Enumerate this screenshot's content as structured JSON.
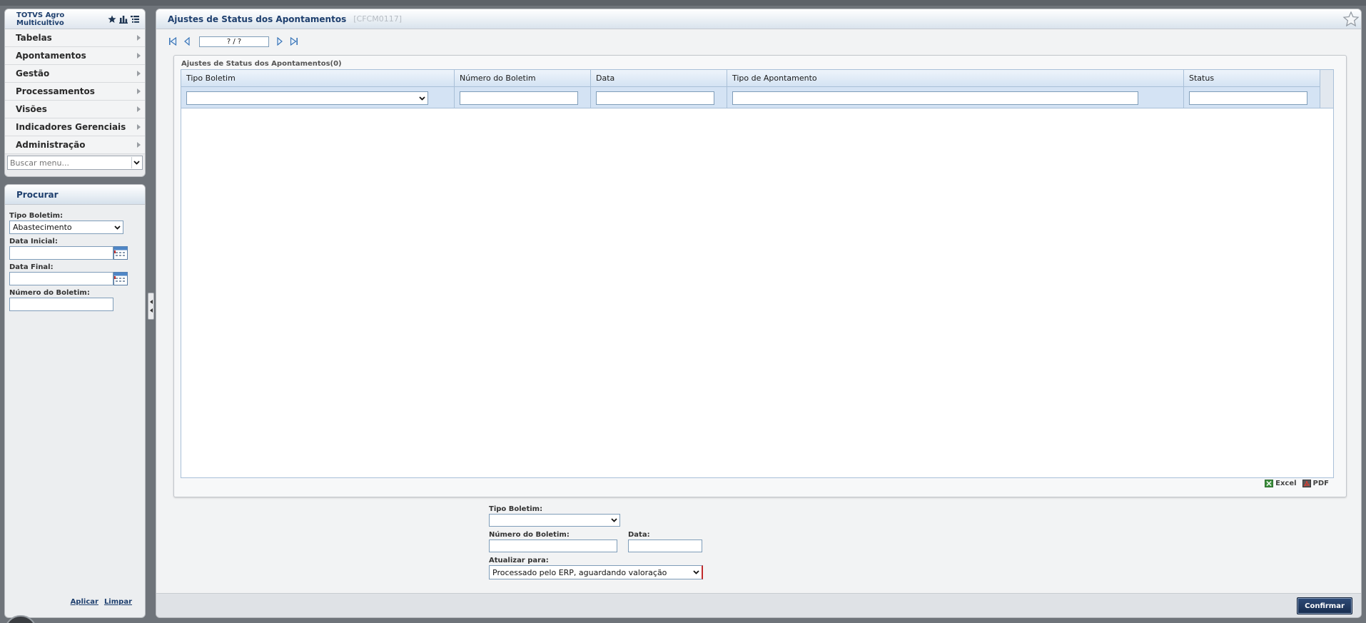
{
  "menu": {
    "title": "TOTVS Agro Multicultivo",
    "items": [
      {
        "label": "Tabelas"
      },
      {
        "label": "Apontamentos"
      },
      {
        "label": "Gestão"
      },
      {
        "label": "Processamentos"
      },
      {
        "label": "Visões"
      },
      {
        "label": "Indicadores Gerenciais"
      },
      {
        "label": "Administração"
      }
    ],
    "search_placeholder": "Buscar menu..."
  },
  "procurar": {
    "title": "Procurar",
    "tipo_boletim_label": "Tipo Boletim:",
    "tipo_boletim_value": "Abastecimento",
    "data_inicial_label": "Data Inicial:",
    "data_final_label": "Data Final:",
    "numero_boletim_label": "Número do Boletim:",
    "apply_label": "Aplicar",
    "clear_label": "Limpar"
  },
  "main": {
    "title": "Ajustes de Status dos Apontamentos",
    "code": "[CFCM0117]",
    "pager_text": "? / ?",
    "grid_caption": "Ajustes de Status dos Apontamentos(0)",
    "columns": [
      {
        "label": "Tipo Boletim"
      },
      {
        "label": "Número do Boletim"
      },
      {
        "label": "Data"
      },
      {
        "label": "Tipo de Apontamento"
      },
      {
        "label": "Status"
      }
    ],
    "export_excel": "Excel",
    "export_pdf": "PDF"
  },
  "form": {
    "tipo_boletim_label": "Tipo Boletim:",
    "numero_boletim_label": "Número do Boletim:",
    "data_label": "Data:",
    "atualizar_label": "Atualizar para:",
    "atualizar_value": "Processado pelo ERP, aguardando valoração",
    "confirm_label": "Confirmar"
  },
  "colors": {
    "title_blue": "#1e3f6e",
    "confirm_bg": "#1f3861",
    "field_border": "#7f9db9",
    "required_border": "#c0292b"
  }
}
